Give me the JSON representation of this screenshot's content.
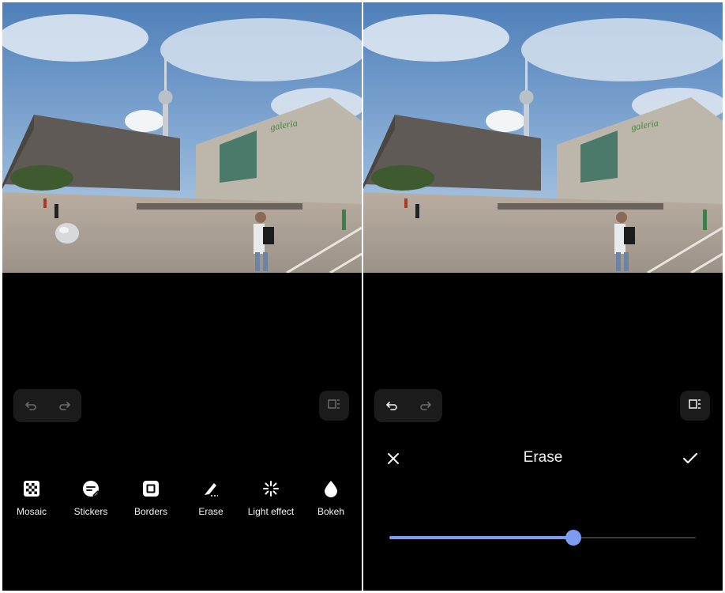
{
  "left_screen": {
    "tools": [
      {
        "label": "Mosaic",
        "icon": "mosaic-icon"
      },
      {
        "label": "Stickers",
        "icon": "stickers-icon"
      },
      {
        "label": "Borders",
        "icon": "borders-icon"
      },
      {
        "label": "Erase",
        "icon": "erase-icon"
      },
      {
        "label": "Light effect",
        "icon": "light-effect-icon"
      },
      {
        "label": "Bokeh",
        "icon": "bokeh-icon"
      }
    ]
  },
  "right_screen": {
    "title": "Erase",
    "brush_size_fraction": 0.6
  },
  "colors": {
    "accent": "#7b9cf0",
    "background": "#000000"
  }
}
